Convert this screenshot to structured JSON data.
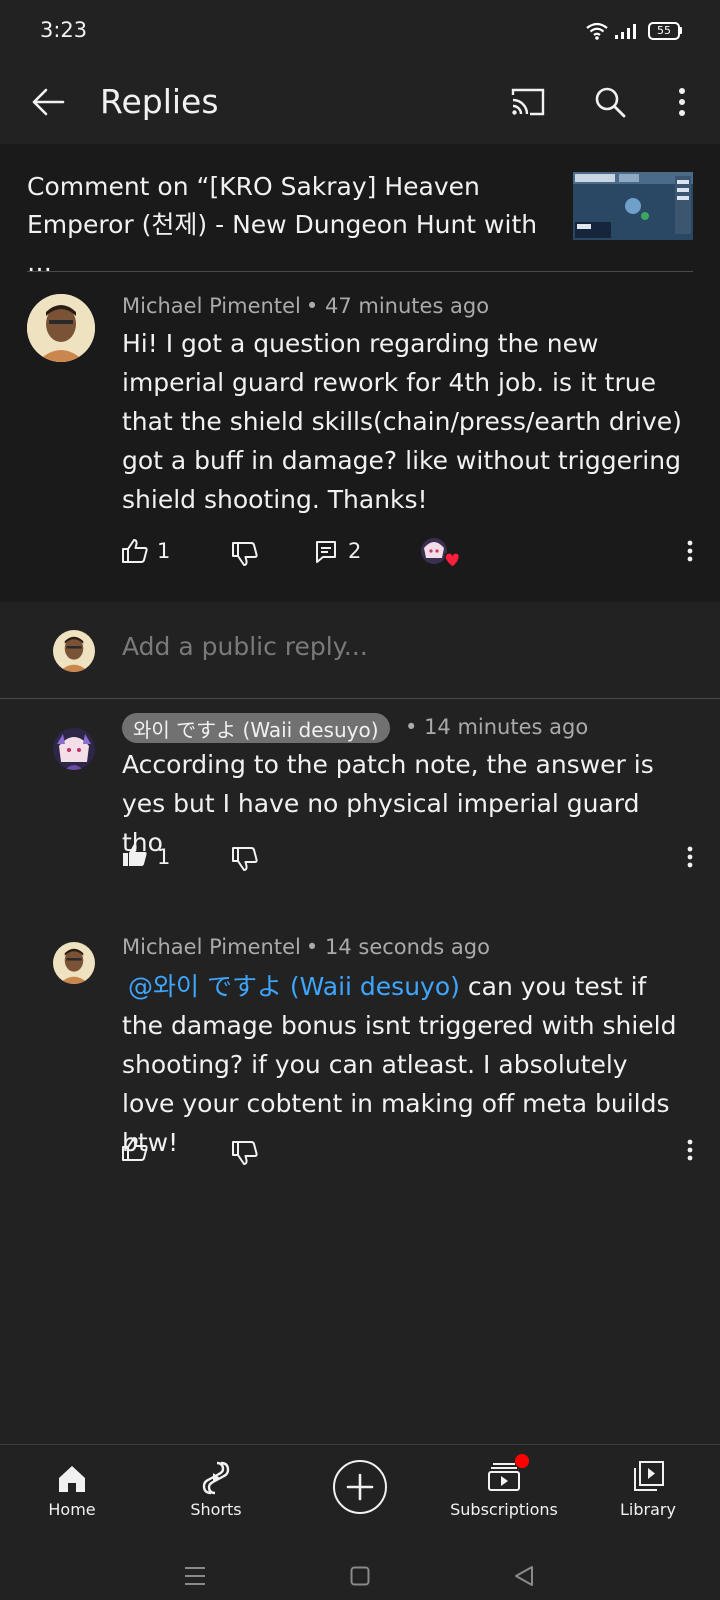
{
  "status_bar": {
    "time": "3:23",
    "battery": "55"
  },
  "header": {
    "title": "Replies"
  },
  "context": {
    "text": "Comment on “[KRO Sakray] Heaven Emperor (천제) - New Dungeon Hunt with …"
  },
  "top_comment": {
    "author": "Michael Pimentel",
    "time": "47 minutes ago",
    "text": "Hi! I got a question regarding the new imperial guard rework for 4th job. is it true that the shield skills(chain/press/earth drive) got a buff in damage? like without triggering shield shooting. Thanks!",
    "likes": "1",
    "replies": "2"
  },
  "reply_box": {
    "placeholder": "Add a public reply..."
  },
  "replies": [
    {
      "author": "와이 ですよ (Waii desuyo)",
      "time": "14 minutes ago",
      "text": "According to the patch note, the answer is yes but I have no physical imperial guard tho",
      "likes": "1"
    },
    {
      "author": "Michael Pimentel",
      "time": "14 seconds ago",
      "mention": "@와이 ですよ (Waii desuyo)",
      "text": "can you test if the damage bonus isnt triggered with shield shooting? if you can atleast. I absolutely love your cobtent in making off meta builds btw!"
    }
  ],
  "bottom_nav": {
    "home": "Home",
    "shorts": "Shorts",
    "subscriptions": "Subscriptions",
    "library": "Library"
  },
  "colors": {
    "background": "#222222",
    "mention": "#3ea6ff",
    "notification_dot": "#ff0000"
  }
}
